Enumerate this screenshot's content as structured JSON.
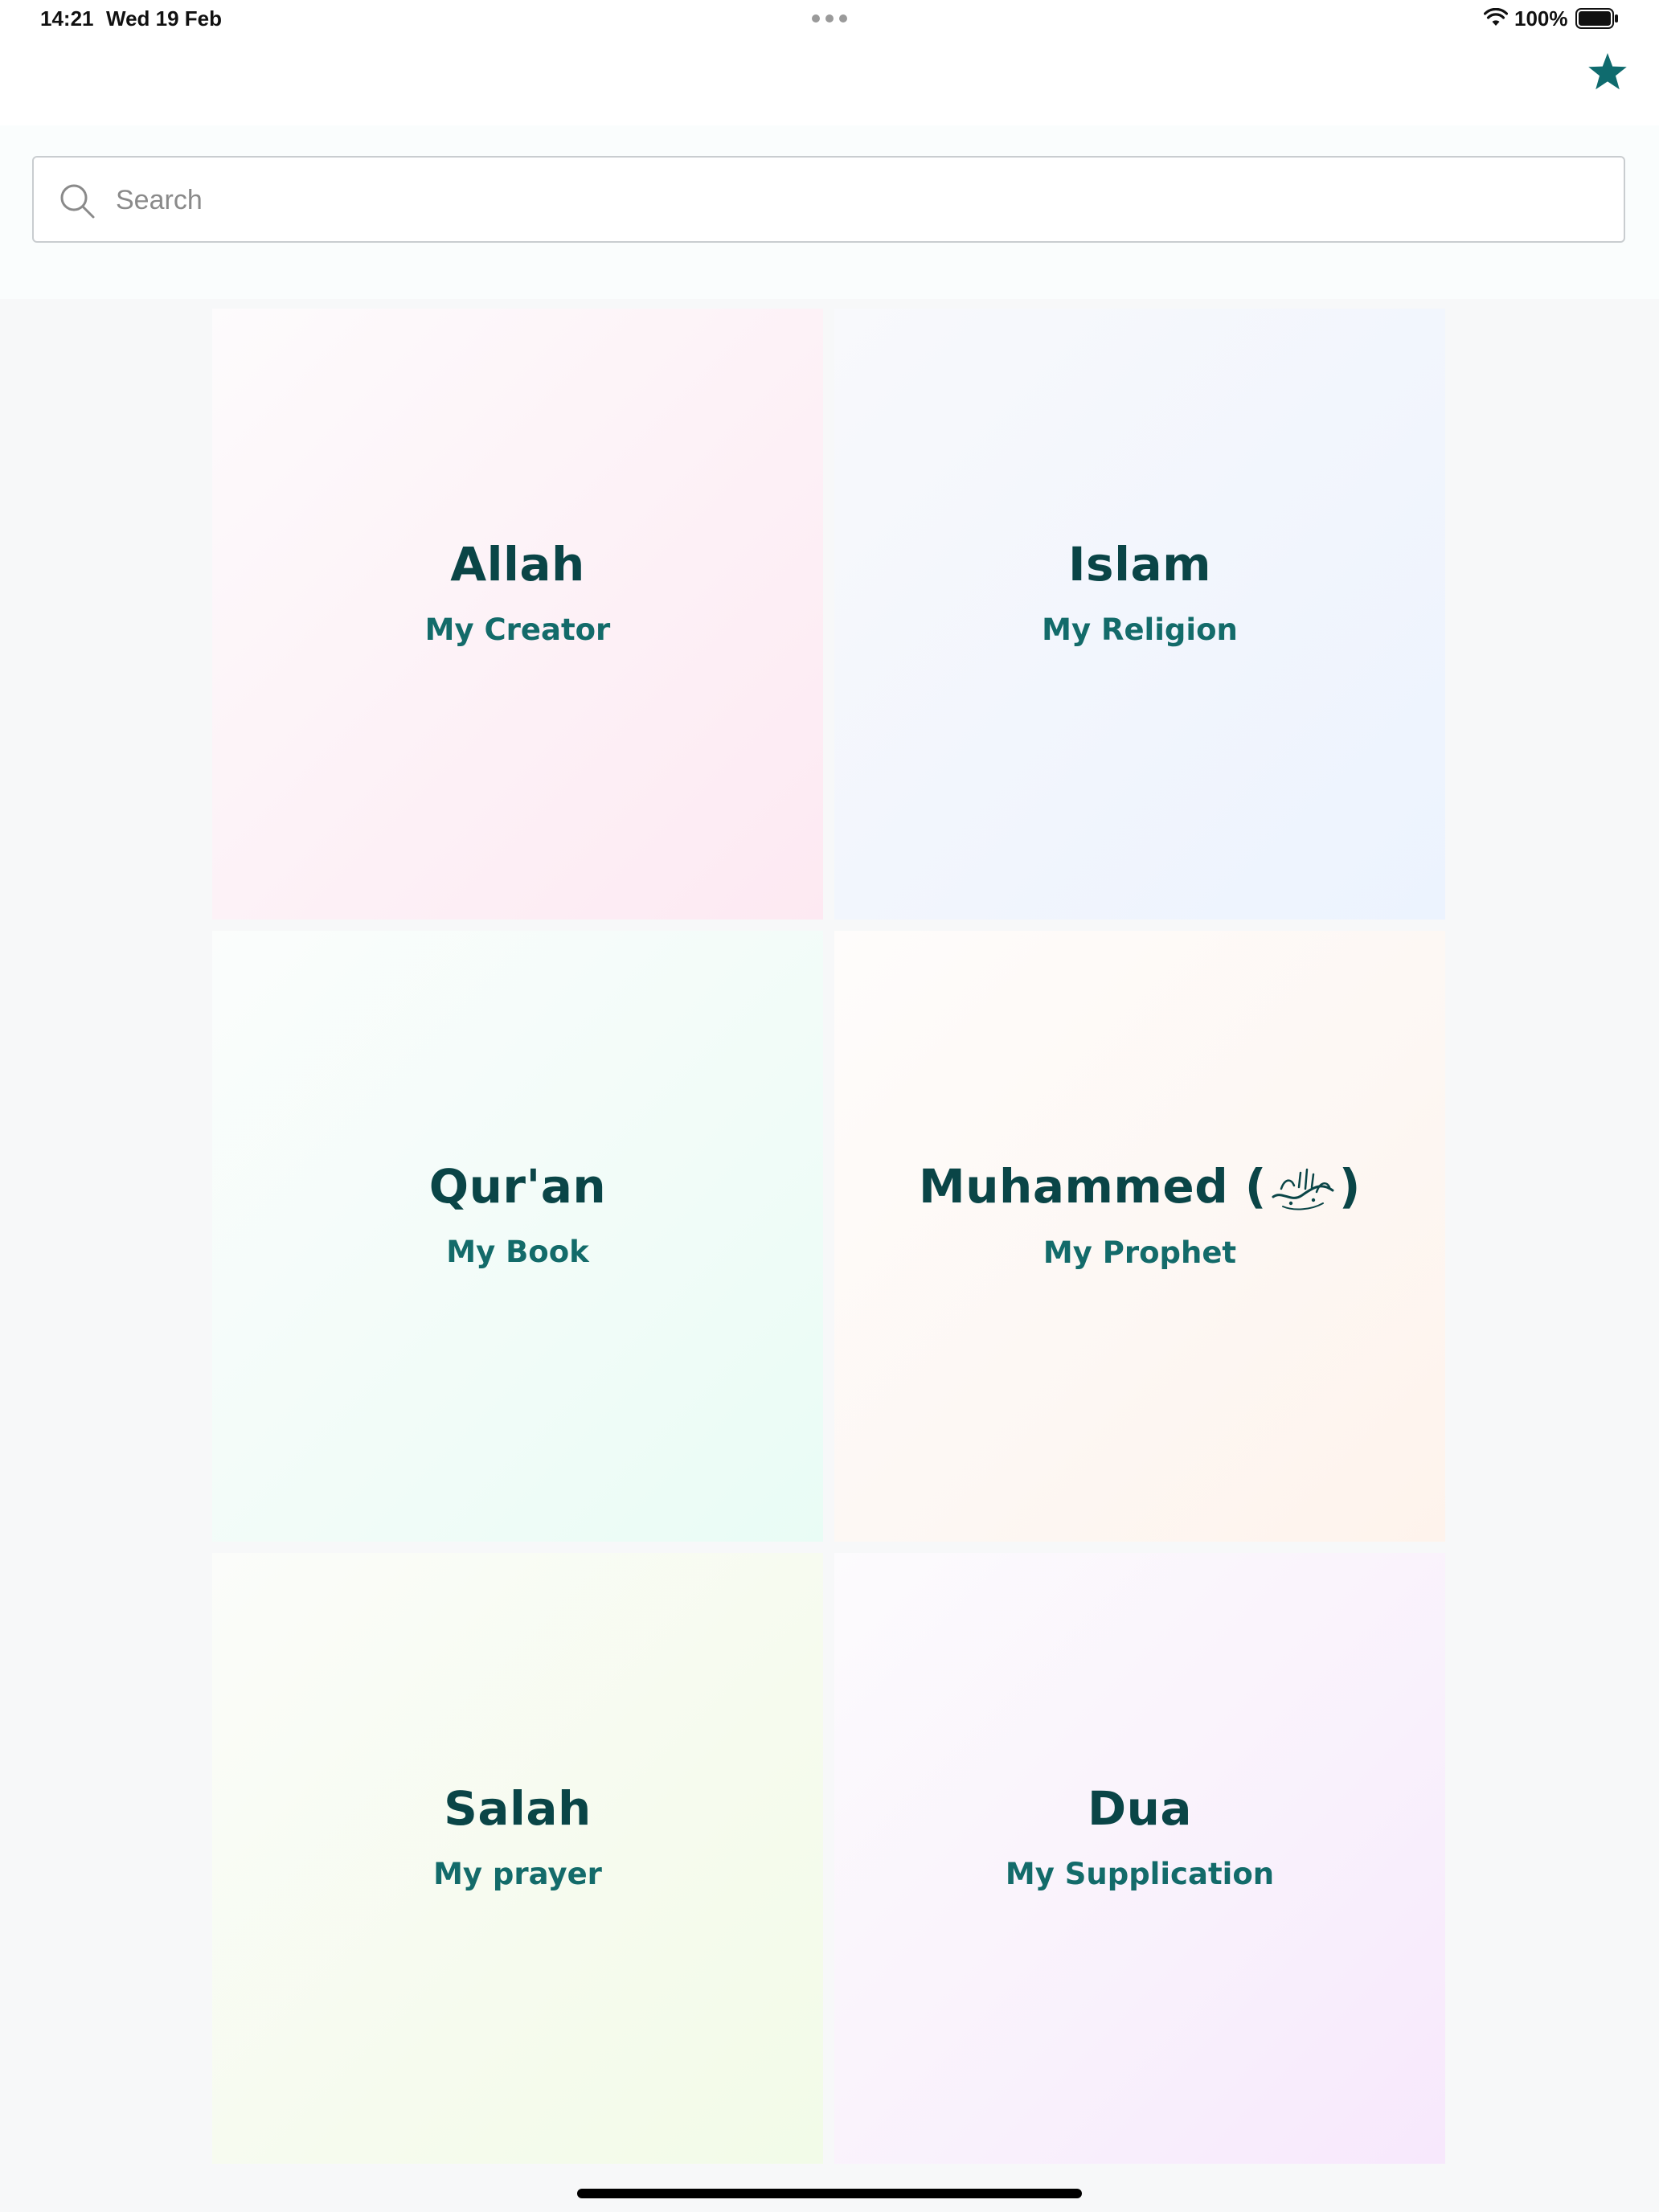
{
  "status_bar": {
    "time": "14:21",
    "date": "Wed 19 Feb",
    "battery": "100%",
    "icons": [
      "wifi-icon",
      "battery-icon"
    ]
  },
  "nav": {
    "favorites_icon": "star-icon",
    "accent_color": "#0f6b6e"
  },
  "search": {
    "placeholder": "Search",
    "value": ""
  },
  "cards": [
    {
      "title": "Allah",
      "subtitle": "My Creator"
    },
    {
      "title": "Islam",
      "subtitle": "My Religion"
    },
    {
      "title": "Qur'an",
      "subtitle": "My Book"
    },
    {
      "title": "Muhammed (",
      "title_suffix": ")",
      "subtitle": "My Prophet"
    },
    {
      "title": "Salah",
      "subtitle": "My prayer"
    },
    {
      "title": "Dua",
      "subtitle": "My Supplication"
    }
  ],
  "colors": {
    "title": "#0a4547",
    "subtitle": "#136b6a"
  }
}
